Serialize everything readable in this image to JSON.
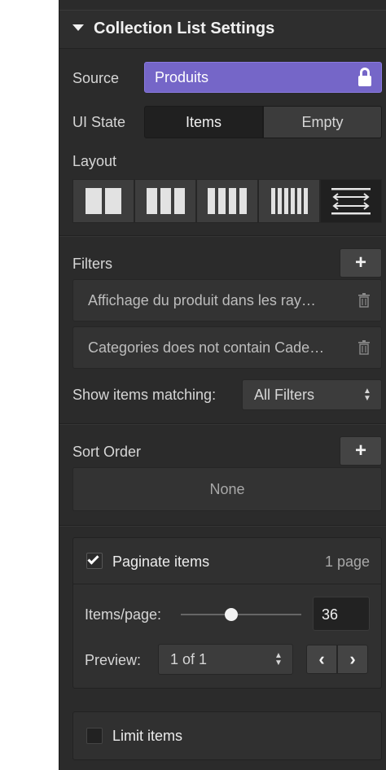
{
  "header": {
    "title": "Collection List Settings",
    "icon": "caret-down-icon"
  },
  "source": {
    "label": "Source",
    "value": "Produits",
    "icon": "lock-icon",
    "color": "#7566c8"
  },
  "ui_state": {
    "label": "UI State",
    "options": [
      "Items",
      "Empty"
    ],
    "selected": "Items"
  },
  "layout": {
    "label": "Layout",
    "options": [
      "2-columns",
      "3-columns",
      "4-columns",
      "6-columns",
      "list"
    ],
    "selected": "list"
  },
  "filters": {
    "label": "Filters",
    "add_icon": "plus-icon",
    "items": [
      "Affichage du produit dans les ray…",
      "Categories does not contain Cade…"
    ],
    "match_label": "Show items matching:",
    "match_value": "All Filters"
  },
  "sort": {
    "label": "Sort Order",
    "add_icon": "plus-icon",
    "value": "None"
  },
  "pagination": {
    "checkbox_label": "Paginate items",
    "checked": true,
    "pages_text": "1 page",
    "items_per_page_label": "Items/page:",
    "items_per_page": "36",
    "slider_fraction": 0.36,
    "preview_label": "Preview:",
    "preview_value": "1 of 1",
    "prev_icon": "chevron-left-icon",
    "next_icon": "chevron-right-icon"
  },
  "limit": {
    "checkbox_label": "Limit items",
    "checked": false
  }
}
